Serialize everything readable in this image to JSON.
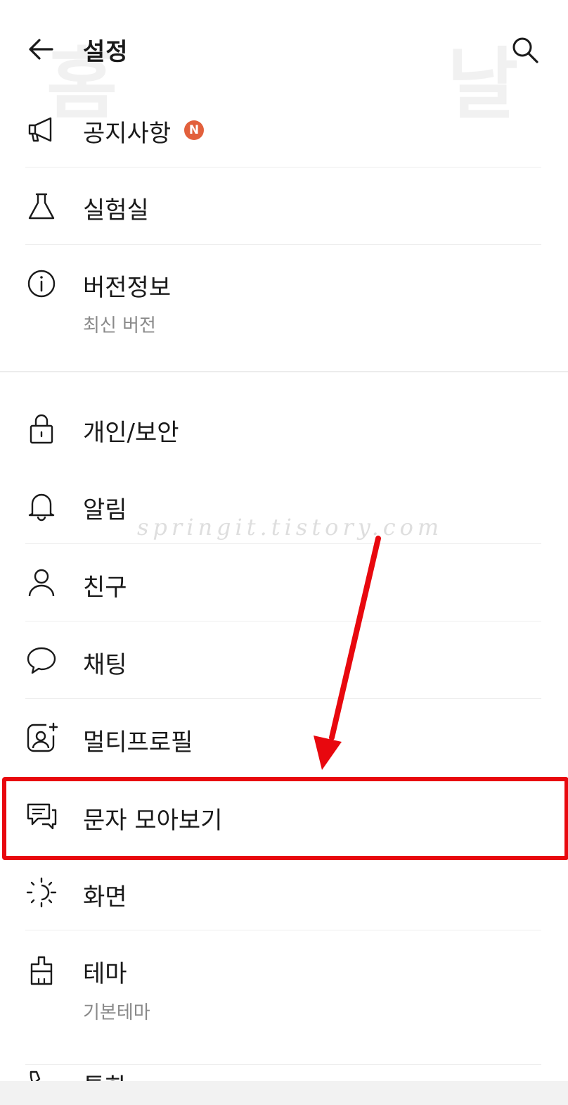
{
  "header": {
    "title": "설정",
    "back_icon": "arrow-left-icon",
    "search_icon": "search-icon"
  },
  "items": [
    {
      "label": "공지사항",
      "icon": "megaphone-icon",
      "badge": "N"
    },
    {
      "label": "실험실",
      "icon": "flask-icon"
    },
    {
      "label": "버전정보",
      "icon": "info-icon",
      "sub": "최신 버전"
    },
    {
      "label": "개인/보안",
      "icon": "lock-icon"
    },
    {
      "label": "알림",
      "icon": "bell-icon"
    },
    {
      "label": "친구",
      "icon": "person-icon"
    },
    {
      "label": "채팅",
      "icon": "chat-bubble-icon"
    },
    {
      "label": "멀티프로필",
      "icon": "multi-profile-icon"
    },
    {
      "label": "문자 모아보기",
      "icon": "messages-icon"
    },
    {
      "label": "화면",
      "icon": "brightness-icon"
    },
    {
      "label": "테마",
      "icon": "theme-icon",
      "sub": "기본테마"
    },
    {
      "label": "통화",
      "icon": "phone-icon"
    }
  ],
  "watermark": "springit.tistory.com",
  "colors": {
    "badge": "#e2603c",
    "highlight": "#e8080e",
    "text": "#1a1a1a",
    "subtext": "#8a8a8a"
  }
}
